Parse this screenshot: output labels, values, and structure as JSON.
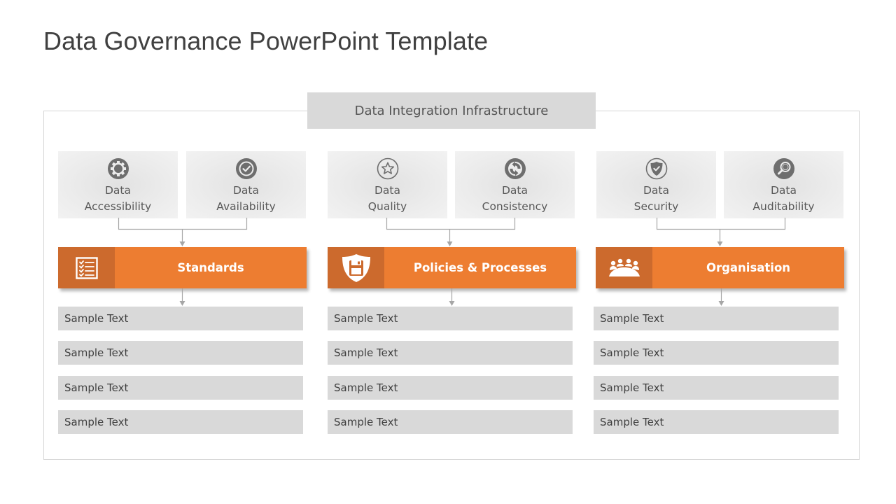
{
  "title": "Data Governance PowerPoint Template",
  "infrastructure_label": "Data Integration Infrastructure",
  "colors": {
    "accent": "#ed7d31",
    "accent_dark": "#cc6a2d",
    "card_bg": "#ececec",
    "item_bg": "#d9d9d9",
    "icon_gray": "#6e6e6e"
  },
  "columns": [
    {
      "cards": [
        {
          "line1": "Data",
          "line2": "Accessibility",
          "icon": "gear-icon"
        },
        {
          "line1": "Data",
          "line2": "Availability",
          "icon": "check-circle-icon"
        }
      ],
      "pillar": {
        "label": "Standards",
        "icon": "checklist-icon"
      },
      "items": [
        "Sample Text",
        "Sample Text",
        "Sample Text",
        "Sample Text"
      ]
    },
    {
      "cards": [
        {
          "line1": "Data",
          "line2": "Quality",
          "icon": "star-icon"
        },
        {
          "line1": "Data",
          "line2": "Consistency",
          "icon": "refresh-icon"
        }
      ],
      "pillar": {
        "label": "Policies & Processes",
        "icon": "shield-save-icon"
      },
      "items": [
        "Sample Text",
        "Sample Text",
        "Sample Text",
        "Sample Text"
      ]
    },
    {
      "cards": [
        {
          "line1": "Data",
          "line2": "Security",
          "icon": "shield-check-icon"
        },
        {
          "line1": "Data",
          "line2": "Auditability",
          "icon": "magnifier-icon"
        }
      ],
      "pillar": {
        "label": "Organisation",
        "icon": "team-meeting-icon"
      },
      "items": [
        "Sample Text",
        "Sample Text",
        "Sample Text",
        "Sample Text"
      ]
    }
  ]
}
